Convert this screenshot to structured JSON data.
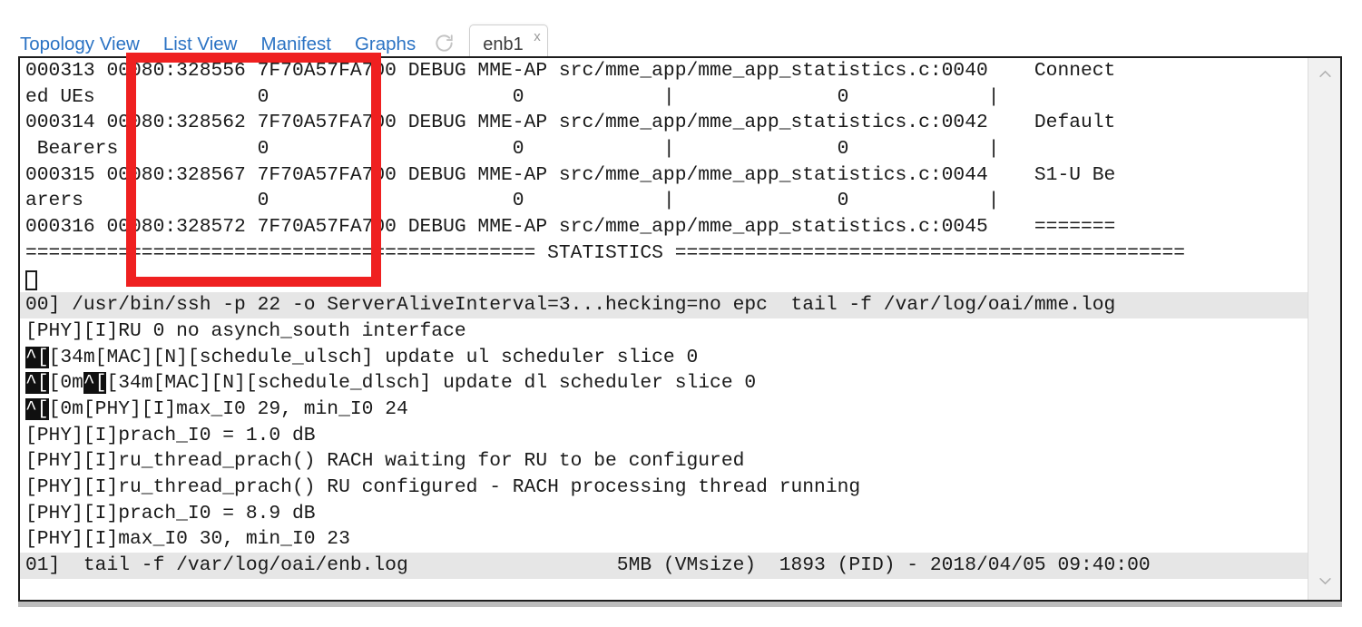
{
  "nav": {
    "links": [
      {
        "label": "Topology View",
        "name": "nav-topology-view"
      },
      {
        "label": "List View",
        "name": "nav-list-view"
      },
      {
        "label": "Manifest",
        "name": "nav-manifest"
      },
      {
        "label": "Graphs",
        "name": "nav-graphs"
      }
    ],
    "refresh_icon": "refresh-icon"
  },
  "tab": {
    "label": "enb1",
    "close_label": "x"
  },
  "terminal": {
    "upper_lines": [
      "000313 00080:328556 7F70A57FA700 DEBUG MME-AP src/mme_app/mme_app_statistics.c:0040    Connect",
      "ed UEs              0                     0            |              0            |",
      "000314 00080:328562 7F70A57FA700 DEBUG MME-AP src/mme_app/mme_app_statistics.c:0042    Default",
      " Bearers            0                     0            |              0            |",
      "000315 00080:328567 7F70A57FA700 DEBUG MME-AP src/mme_app/mme_app_statistics.c:0044    S1-U Be",
      "arers               0                     0            |              0            |",
      "000316 00080:328572 7F70A57FA700 DEBUG MME-AP src/mme_app/mme_app_statistics.c:0045    =======",
      "============================================ STATISTICS ============================================"
    ],
    "upper_status": "00] /usr/bin/ssh -p 22 -o ServerAliveInterval=3...hecking=no epc  tail -f /var/log/oai/mme.log",
    "lower_lines": [
      {
        "pre": "",
        "esc": "",
        "text": "[PHY][I]RU 0 no asynch_south interface"
      },
      {
        "pre": "",
        "esc": "^[",
        "text": "[34m[MAC][N][schedule_ulsch] update ul scheduler slice 0"
      },
      {
        "pre": "",
        "esc": "^[",
        "text": "[0m",
        "esc2": "^[",
        "text2": "[34m[MAC][N][schedule_dlsch] update dl scheduler slice 0"
      },
      {
        "pre": "",
        "esc": "^[",
        "text": "[0m[PHY][I]max_I0 29, min_I0 24"
      },
      {
        "pre": "",
        "esc": "",
        "text": "[PHY][I]prach_I0 = 1.0 dB"
      },
      {
        "pre": "",
        "esc": "",
        "text": "[PHY][I]ru_thread_prach() RACH waiting for RU to be configured"
      },
      {
        "pre": "",
        "esc": "",
        "text": "[PHY][I]ru_thread_prach() RU configured - RACH processing thread running"
      },
      {
        "pre": "",
        "esc": "",
        "text": "[PHY][I]prach_I0 = 8.9 dB"
      },
      {
        "pre": "",
        "esc": "",
        "text": "[PHY][I]max_I0 30, min_I0 23"
      }
    ],
    "lower_status": "01]  tail -f /var/log/oai/enb.log                  5MB (VMsize)  1893 (PID) - 2018/04/05 09:40:00"
  },
  "colors": {
    "link": "#2b73c4",
    "annotation": "#ef2020",
    "status_bg": "#e6e6e6",
    "terminal_fg": "#1a1a1a",
    "frame_border": "#1d1d1d"
  }
}
